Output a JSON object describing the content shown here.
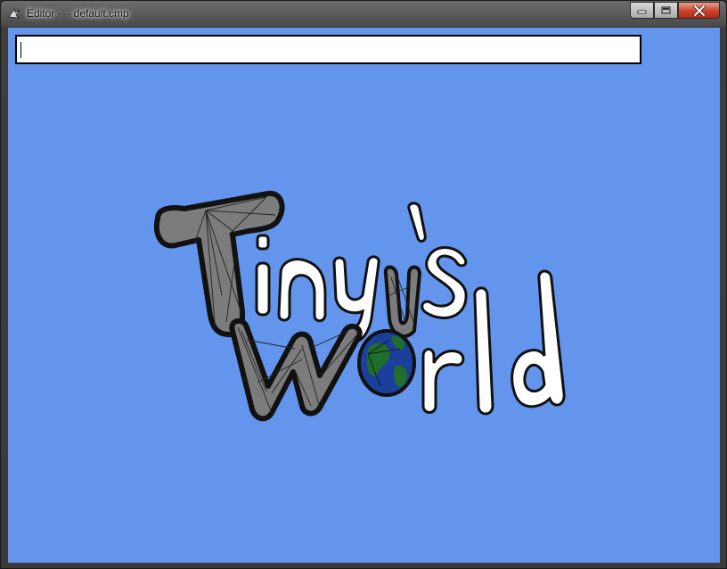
{
  "window": {
    "title": "Editor -  - default.cmp",
    "controls": {
      "minimize_icon": "minimize-icon",
      "maximize_icon": "maximize-icon",
      "close_icon": "close-icon"
    }
  },
  "editor": {
    "command_input_value": "",
    "background_color": "#6495ed"
  },
  "logo": {
    "word_1": "Tiny's",
    "word_2": "World",
    "colors": {
      "stone_fill": "#7c7c7c",
      "outline": "#111111",
      "letter_fill": "#ffffff",
      "ocean": "#1b3f9a",
      "land": "#1f6e2b"
    }
  }
}
